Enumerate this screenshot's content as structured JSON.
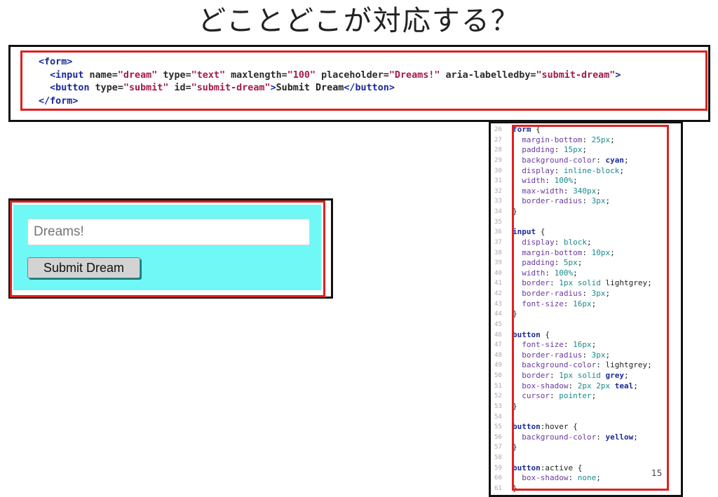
{
  "title": "どことどこが対応する？",
  "page_number": "15",
  "html_code": {
    "line1": {
      "open": "<form>"
    },
    "line2": {
      "tag_open": "<input",
      "a1": " name=",
      "v1": "\"dream\"",
      "a2": " type=",
      "v2": "\"text\"",
      "a3": " maxlength=",
      "v3": "\"100\"",
      "a4": " placeholder=",
      "v4": "\"Dreams!\"",
      "a5": " aria-labelledby=",
      "v5": "\"submit-dream\"",
      "tag_close": ">"
    },
    "line3": {
      "tag_open": "<button",
      "a1": " type=",
      "v1": "\"submit\"",
      "a2": " id=",
      "v2": "\"submit-dream\"",
      "gt": ">",
      "text": "Submit Dream",
      "tag_end": "</button>"
    },
    "line4": {
      "close": "</form>"
    }
  },
  "preview": {
    "input_placeholder": "Dreams!",
    "button_label": "Submit Dream"
  },
  "css_code": [
    {
      "n": "26",
      "parts": [
        [
          "sel",
          "form"
        ],
        [
          "code",
          " {"
        ]
      ]
    },
    {
      "n": "27",
      "parts": [
        [
          "prop",
          "  margin-bottom"
        ],
        [
          "code",
          ": "
        ],
        [
          "val",
          "25px"
        ],
        [
          "code",
          ";"
        ]
      ]
    },
    {
      "n": "28",
      "parts": [
        [
          "prop",
          "  padding"
        ],
        [
          "code",
          ": "
        ],
        [
          "val",
          "15px"
        ],
        [
          "code",
          ";"
        ]
      ]
    },
    {
      "n": "29",
      "parts": [
        [
          "prop",
          "  background-color"
        ],
        [
          "code",
          ": "
        ],
        [
          "kw",
          "cyan"
        ],
        [
          "code",
          ";"
        ]
      ]
    },
    {
      "n": "30",
      "parts": [
        [
          "prop",
          "  display"
        ],
        [
          "code",
          ": "
        ],
        [
          "val",
          "inline-block"
        ],
        [
          "code",
          ";"
        ]
      ]
    },
    {
      "n": "31",
      "parts": [
        [
          "prop",
          "  width"
        ],
        [
          "code",
          ": "
        ],
        [
          "val",
          "100%"
        ],
        [
          "code",
          ";"
        ]
      ]
    },
    {
      "n": "32",
      "parts": [
        [
          "prop",
          "  max-width"
        ],
        [
          "code",
          ": "
        ],
        [
          "val",
          "340px"
        ],
        [
          "code",
          ";"
        ]
      ]
    },
    {
      "n": "33",
      "parts": [
        [
          "prop",
          "  border-radius"
        ],
        [
          "code",
          ": "
        ],
        [
          "val",
          "3px"
        ],
        [
          "code",
          ";"
        ]
      ]
    },
    {
      "n": "34",
      "parts": [
        [
          "code",
          "}"
        ]
      ]
    },
    {
      "n": "35",
      "parts": [
        [
          "code",
          ""
        ]
      ]
    },
    {
      "n": "36",
      "parts": [
        [
          "sel",
          "input"
        ],
        [
          "code",
          " {"
        ]
      ]
    },
    {
      "n": "37",
      "parts": [
        [
          "prop",
          "  display"
        ],
        [
          "code",
          ": "
        ],
        [
          "val",
          "block"
        ],
        [
          "code",
          ";"
        ]
      ]
    },
    {
      "n": "38",
      "parts": [
        [
          "prop",
          "  margin-bottom"
        ],
        [
          "code",
          ": "
        ],
        [
          "val",
          "10px"
        ],
        [
          "code",
          ";"
        ]
      ]
    },
    {
      "n": "39",
      "parts": [
        [
          "prop",
          "  padding"
        ],
        [
          "code",
          ": "
        ],
        [
          "val",
          "5px"
        ],
        [
          "code",
          ";"
        ]
      ]
    },
    {
      "n": "40",
      "parts": [
        [
          "prop",
          "  width"
        ],
        [
          "code",
          ": "
        ],
        [
          "val",
          "100%"
        ],
        [
          "code",
          ";"
        ]
      ]
    },
    {
      "n": "41",
      "parts": [
        [
          "prop",
          "  border"
        ],
        [
          "code",
          ": "
        ],
        [
          "val",
          "1px"
        ],
        [
          "code",
          " "
        ],
        [
          "val",
          "solid"
        ],
        [
          "code",
          " lightgrey;"
        ]
      ]
    },
    {
      "n": "42",
      "parts": [
        [
          "prop",
          "  border-radius"
        ],
        [
          "code",
          ": "
        ],
        [
          "val",
          "3px"
        ],
        [
          "code",
          ";"
        ]
      ]
    },
    {
      "n": "43",
      "parts": [
        [
          "prop",
          "  font-size"
        ],
        [
          "code",
          ": "
        ],
        [
          "val",
          "16px"
        ],
        [
          "code",
          ";"
        ]
      ]
    },
    {
      "n": "44",
      "parts": [
        [
          "code",
          "}"
        ]
      ]
    },
    {
      "n": "45",
      "parts": [
        [
          "code",
          ""
        ]
      ]
    },
    {
      "n": "46",
      "parts": [
        [
          "sel",
          "button"
        ],
        [
          "code",
          " {"
        ]
      ]
    },
    {
      "n": "47",
      "parts": [
        [
          "prop",
          "  font-size"
        ],
        [
          "code",
          ": "
        ],
        [
          "val",
          "16px"
        ],
        [
          "code",
          ";"
        ]
      ]
    },
    {
      "n": "48",
      "parts": [
        [
          "prop",
          "  border-radius"
        ],
        [
          "code",
          ": "
        ],
        [
          "val",
          "3px"
        ],
        [
          "code",
          ";"
        ]
      ]
    },
    {
      "n": "49",
      "parts": [
        [
          "prop",
          "  background-color"
        ],
        [
          "code",
          ": lightgrey;"
        ]
      ]
    },
    {
      "n": "50",
      "parts": [
        [
          "prop",
          "  border"
        ],
        [
          "code",
          ": "
        ],
        [
          "val",
          "1px"
        ],
        [
          "code",
          " "
        ],
        [
          "val",
          "solid"
        ],
        [
          "code",
          " "
        ],
        [
          "kw",
          "grey"
        ],
        [
          "code",
          ";"
        ]
      ]
    },
    {
      "n": "51",
      "parts": [
        [
          "prop",
          "  box-shadow"
        ],
        [
          "code",
          ": "
        ],
        [
          "val",
          "2px"
        ],
        [
          "code",
          " "
        ],
        [
          "val",
          "2px"
        ],
        [
          "code",
          " "
        ],
        [
          "kw",
          "teal"
        ],
        [
          "code",
          ";"
        ]
      ]
    },
    {
      "n": "52",
      "parts": [
        [
          "prop",
          "  cursor"
        ],
        [
          "code",
          ": "
        ],
        [
          "val",
          "pointer"
        ],
        [
          "code",
          ";"
        ]
      ]
    },
    {
      "n": "53",
      "parts": [
        [
          "code",
          "}"
        ]
      ]
    },
    {
      "n": "54",
      "parts": [
        [
          "code",
          ""
        ]
      ]
    },
    {
      "n": "55",
      "parts": [
        [
          "sel",
          "button"
        ],
        [
          "code",
          ":hover {"
        ]
      ]
    },
    {
      "n": "56",
      "parts": [
        [
          "prop",
          "  background-color"
        ],
        [
          "code",
          ": "
        ],
        [
          "kw",
          "yellow"
        ],
        [
          "code",
          ";"
        ]
      ]
    },
    {
      "n": "57",
      "parts": [
        [
          "code",
          "}"
        ]
      ]
    },
    {
      "n": "58",
      "parts": [
        [
          "code",
          ""
        ]
      ]
    },
    {
      "n": "59",
      "parts": [
        [
          "sel",
          "button"
        ],
        [
          "code",
          ":active {"
        ]
      ]
    },
    {
      "n": "60",
      "parts": [
        [
          "prop",
          "  box-shadow"
        ],
        [
          "code",
          ": "
        ],
        [
          "val",
          "none"
        ],
        [
          "code",
          ";"
        ]
      ]
    },
    {
      "n": "61",
      "parts": [
        [
          "code",
          "}"
        ]
      ]
    }
  ]
}
